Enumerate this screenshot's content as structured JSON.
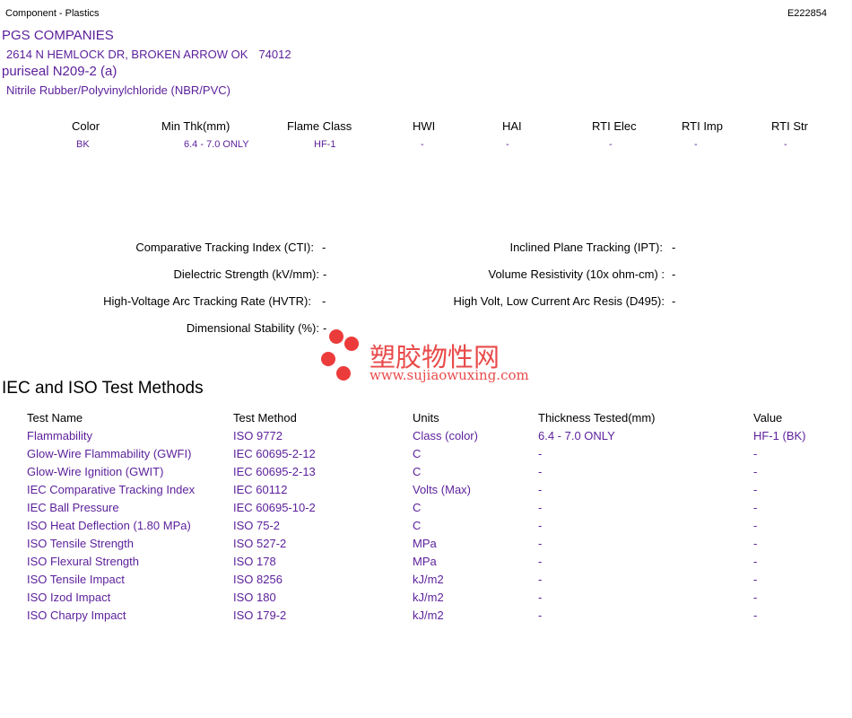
{
  "header": {
    "category": "Component - Plastics",
    "file_number": "E222854"
  },
  "company": {
    "name": "PGS COMPANIES",
    "address": "2614 N HEMLOCK DR, BROKEN ARROW OK",
    "zip": "74012"
  },
  "product": {
    "name": "puriseal N209-2 (a)",
    "material": "Nitrile Rubber/Polyvinylchloride (NBR/PVC)"
  },
  "properties": {
    "headers": [
      "Color",
      "Min Thk(mm)",
      "Flame Class",
      "HWI",
      "HAI",
      "RTI Elec",
      "RTI Imp",
      "RTI Str"
    ],
    "values": [
      "BK",
      "6.4 - 7.0 ONLY",
      "HF-1",
      "-",
      "-",
      "-",
      "-",
      "-"
    ]
  },
  "electrical": {
    "cti_label": "Comparative Tracking Index (CTI):",
    "cti_value": "-",
    "ipt_label": "Inclined Plane Tracking (IPT):",
    "ipt_value": "-",
    "ds_label": "Dielectric Strength (kV/mm):",
    "ds_value": "-",
    "vr_label": "Volume Resistivity (10x ohm-cm) :",
    "vr_value": "-",
    "hvtr_label": "High-Voltage Arc Tracking Rate (HVTR):",
    "hvtr_value": "-",
    "d495_label": "High Volt, Low Current Arc Resis (D495):",
    "d495_value": "-",
    "dim_label": "Dimensional Stability (%):",
    "dim_value": "-"
  },
  "watermark": {
    "chinese": "塑胶物性网",
    "url": "www.sujiaowuxing.com"
  },
  "iec": {
    "title": "IEC and ISO Test Methods",
    "headers": [
      "Test Name",
      "Test Method",
      "Units",
      "Thickness Tested(mm)",
      "Value"
    ],
    "rows": [
      [
        "Flammability",
        "ISO 9772",
        "Class (color)",
        "6.4 - 7.0 ONLY",
        "HF-1 (BK)"
      ],
      [
        "Glow-Wire Flammability (GWFI)",
        "IEC 60695-2-12",
        "C",
        "-",
        "-"
      ],
      [
        "Glow-Wire Ignition (GWIT)",
        "IEC 60695-2-13",
        "C",
        "-",
        "-"
      ],
      [
        "IEC Comparative Tracking Index",
        "IEC 60112",
        "Volts (Max)",
        "-",
        "-"
      ],
      [
        "IEC Ball Pressure",
        "IEC 60695-10-2",
        "C",
        "-",
        "-"
      ],
      [
        "ISO Heat Deflection (1.80 MPa)",
        "ISO 75-2",
        "C",
        "-",
        "-"
      ],
      [
        "ISO Tensile Strength",
        "ISO 527-2",
        "MPa",
        "-",
        "-"
      ],
      [
        "ISO Flexural Strength",
        "ISO 178",
        "MPa",
        "-",
        "-"
      ],
      [
        "ISO Tensile Impact",
        "ISO 8256",
        "kJ/m2",
        "-",
        "-"
      ],
      [
        "ISO Izod Impact",
        "ISO 180",
        "kJ/m2",
        "-",
        "-"
      ],
      [
        "ISO Charpy Impact",
        "ISO 179-2",
        "kJ/m2",
        "-",
        "-"
      ]
    ]
  }
}
